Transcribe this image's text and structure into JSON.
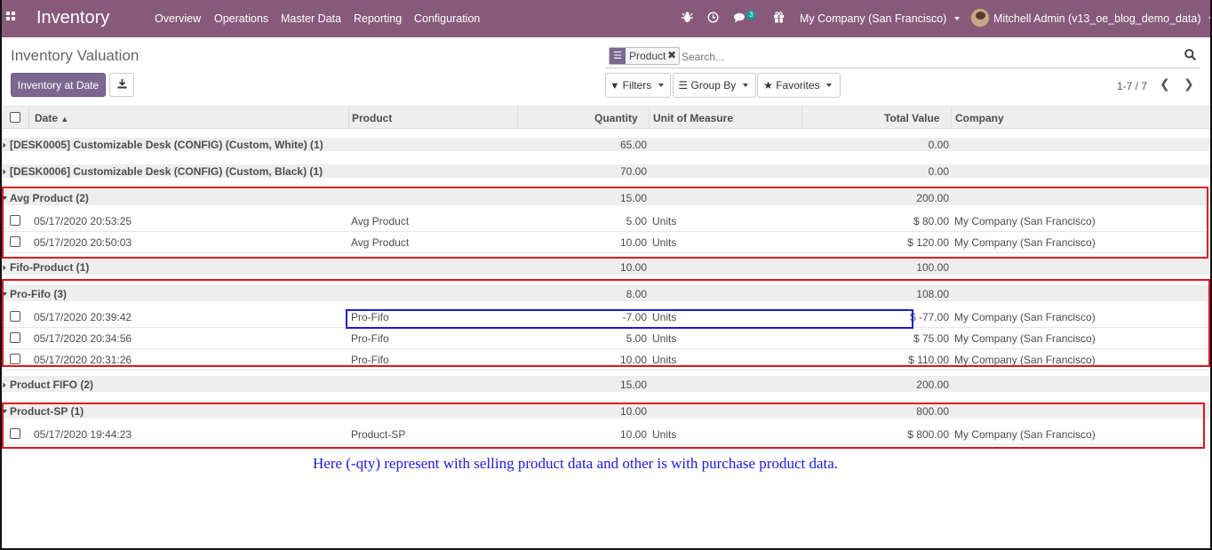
{
  "navbar": {
    "brand": "Inventory",
    "menu": [
      "Overview",
      "Operations",
      "Master Data",
      "Reporting",
      "Configuration"
    ],
    "message_count": "3",
    "company": "My Company (San Francisco)",
    "user": "Mitchell Admin (v13_oe_blog_demo_data)",
    "bg_color": "#875a7b"
  },
  "control_panel": {
    "title": "Inventory Valuation",
    "inventory_at_date_label": "Inventory at Date",
    "search_facet": "Product",
    "search_placeholder": "Search...",
    "filters_label": "Filters",
    "group_by_label": "Group By",
    "favorites_label": "Favorites",
    "pager": "1-7 / 7"
  },
  "table": {
    "headers": {
      "date": "Date",
      "product": "Product",
      "quantity": "Quantity",
      "uom": "Unit of Measure",
      "total_value": "Total Value",
      "company": "Company"
    },
    "rows": [
      {
        "type": "group",
        "label": "[DESK0005] Customizable Desk (CONFIG) (Custom, White) (1)",
        "quantity": "65.00",
        "total_value": "0.00"
      },
      {
        "type": "group",
        "label": "[DESK0006] Customizable Desk (CONFIG) (Custom, Black) (1)",
        "quantity": "70.00",
        "total_value": "0.00"
      },
      {
        "type": "group",
        "label": "Avg Product (2)",
        "quantity": "15.00",
        "total_value": "200.00",
        "open": true
      },
      {
        "type": "record",
        "date": "05/17/2020 20:53:25",
        "product": "Avg Product",
        "quantity": "5.00",
        "uom": "Units",
        "total_value": "$ 80.00",
        "company": "My Company (San Francisco)"
      },
      {
        "type": "record",
        "date": "05/17/2020 20:50:03",
        "product": "Avg Product",
        "quantity": "10.00",
        "uom": "Units",
        "total_value": "$ 120.00",
        "company": "My Company (San Francisco)"
      },
      {
        "type": "group",
        "label": "Fifo-Product (1)",
        "quantity": "10.00",
        "total_value": "100.00"
      },
      {
        "type": "group",
        "label": "Pro-Fifo (3)",
        "quantity": "8.00",
        "total_value": "108.00",
        "open": true
      },
      {
        "type": "record",
        "date": "05/17/2020 20:39:42",
        "product": "Pro-Fifo",
        "quantity": "-7.00",
        "uom": "Units",
        "total_value": "$ -77.00",
        "company": "My Company (San Francisco)"
      },
      {
        "type": "record",
        "date": "05/17/2020 20:34:56",
        "product": "Pro-Fifo",
        "quantity": "5.00",
        "uom": "Units",
        "total_value": "$ 75.00",
        "company": "My Company (San Francisco)"
      },
      {
        "type": "record",
        "date": "05/17/2020 20:31:26",
        "product": "Pro-Fifo",
        "quantity": "10.00",
        "uom": "Units",
        "total_value": "$ 110.00",
        "company": "My Company (San Francisco)"
      },
      {
        "type": "group",
        "label": "Product FIFO (2)",
        "quantity": "15.00",
        "total_value": "200.00"
      },
      {
        "type": "group",
        "label": "Product-SP (1)",
        "quantity": "10.00",
        "total_value": "800.00",
        "open": true
      },
      {
        "type": "record",
        "date": "05/17/2020 19:44:23",
        "product": "Product-SP",
        "quantity": "10.00",
        "uom": "Units",
        "total_value": "$ 800.00",
        "company": "My Company (San Francisco)"
      }
    ]
  },
  "annotation": {
    "note": "Here (-qty) represent with selling product data and other is with purchase product data.",
    "red_box_color": "#e0141e",
    "blue_box_color": "#1b1bd0",
    "note_color": "#1a1ae0"
  }
}
